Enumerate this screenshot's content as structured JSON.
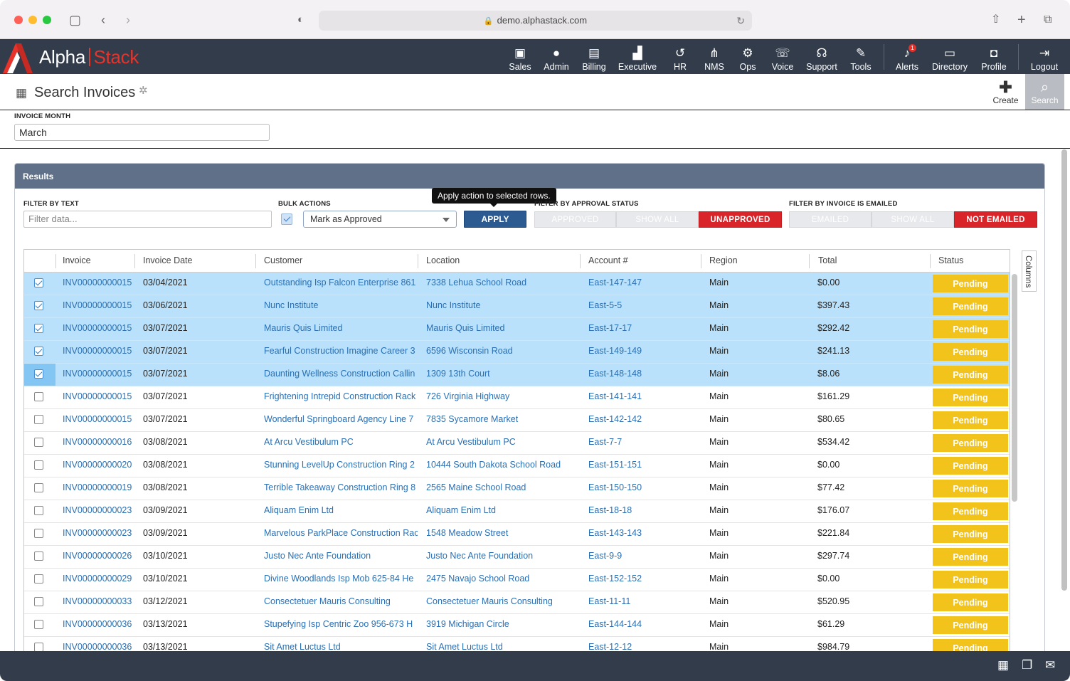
{
  "browser": {
    "url": "demo.alphastack.com"
  },
  "app": {
    "brand_part1": "Alpha",
    "brand_part2": "Stack",
    "accent_color": "#e8332a",
    "header_color": "#323c4b"
  },
  "nav": [
    {
      "label": "Sales",
      "icon": "sales-icon",
      "glyph": "▣"
    },
    {
      "label": "Admin",
      "icon": "admin-user-icon",
      "glyph": "●"
    },
    {
      "label": "Billing",
      "icon": "billing-icon",
      "glyph": "▤"
    },
    {
      "label": "Executive",
      "icon": "executive-chart-icon",
      "glyph": "▟"
    },
    {
      "label": "HR",
      "icon": "hr-icon",
      "glyph": "↺"
    },
    {
      "label": "NMS",
      "icon": "nms-network-icon",
      "glyph": "⋔"
    },
    {
      "label": "Ops",
      "icon": "ops-gears-icon",
      "glyph": "⚙"
    },
    {
      "label": "Voice",
      "icon": "voice-icon",
      "glyph": "☏"
    },
    {
      "label": "Support",
      "icon": "support-headset-icon",
      "glyph": "☊"
    },
    {
      "label": "Tools",
      "icon": "tools-wrench-icon",
      "glyph": "✎"
    },
    {
      "label": "Alerts",
      "icon": "alerts-bell-icon",
      "glyph": "♪",
      "badge": "1"
    },
    {
      "label": "Directory",
      "icon": "directory-icon",
      "glyph": "▭"
    },
    {
      "label": "Profile",
      "icon": "profile-icon",
      "glyph": "◘"
    },
    {
      "label": "Logout",
      "icon": "logout-icon",
      "glyph": "⇥"
    }
  ],
  "page": {
    "title": "Search Invoices",
    "create_label": "Create",
    "search_label": "Search"
  },
  "filters": {
    "invoice_month_label": "INVOICE MONTH",
    "invoice_month_value": "March"
  },
  "results": {
    "title": "Results",
    "filter_text_label": "FILTER BY TEXT",
    "filter_text_placeholder": "Filter data...",
    "bulk_actions_label": "BULK ACTIONS",
    "bulk_action_value": "Mark as Approved",
    "apply_label": "APPLY",
    "apply_tooltip": "Apply action to selected rows.",
    "approval_label": "FILTER BY APPROVAL STATUS",
    "approval_options": [
      "APPROVED",
      "SHOW ALL",
      "UNAPPROVED"
    ],
    "approval_active": "UNAPPROVED",
    "emailed_label": "FILTER BY INVOICE IS EMAILED",
    "emailed_options": [
      "EMAILED",
      "SHOW ALL",
      "NOT EMAILED"
    ],
    "emailed_active": "NOT EMAILED",
    "columns_tab": "Columns",
    "columns": [
      "Invoice",
      "Invoice Date",
      "Customer",
      "Location",
      "Account #",
      "Region",
      "Total",
      "Status"
    ],
    "rows": [
      {
        "selected": true,
        "invoice": "INV00000000015",
        "date": "03/04/2021",
        "customer": "Outstanding Isp Falcon Enterprise 861",
        "location": "7338 Lehua School Road",
        "account": "East-147-147",
        "region": "Main",
        "total": "$0.00",
        "status": "Pending"
      },
      {
        "selected": true,
        "invoice": "INV00000000015",
        "date": "03/06/2021",
        "customer": "Nunc Institute",
        "location": "Nunc Institute",
        "account": "East-5-5",
        "region": "Main",
        "total": "$397.43",
        "status": "Pending"
      },
      {
        "selected": true,
        "invoice": "INV00000000015",
        "date": "03/07/2021",
        "customer": "Mauris Quis Limited",
        "location": "Mauris Quis Limited",
        "account": "East-17-17",
        "region": "Main",
        "total": "$292.42",
        "status": "Pending"
      },
      {
        "selected": true,
        "invoice": "INV00000000015",
        "date": "03/07/2021",
        "customer": "Fearful Construction Imagine Career 3",
        "location": "6596 Wisconsin Road",
        "account": "East-149-149",
        "region": "Main",
        "total": "$241.13",
        "status": "Pending"
      },
      {
        "selected": true,
        "invoice": "INV00000000015",
        "date": "03/07/2021",
        "customer": "Daunting Wellness Construction Callin",
        "location": "1309 13th Court",
        "account": "East-148-148",
        "region": "Main",
        "total": "$8.06",
        "status": "Pending"
      },
      {
        "selected": false,
        "invoice": "INV00000000015",
        "date": "03/07/2021",
        "customer": "Frightening Intrepid Construction Rack",
        "location": "726 Virginia Highway",
        "account": "East-141-141",
        "region": "Main",
        "total": "$161.29",
        "status": "Pending"
      },
      {
        "selected": false,
        "invoice": "INV00000000015",
        "date": "03/07/2021",
        "customer": "Wonderful Springboard Agency Line 7",
        "location": "7835 Sycamore Market",
        "account": "East-142-142",
        "region": "Main",
        "total": "$80.65",
        "status": "Pending"
      },
      {
        "selected": false,
        "invoice": "INV00000000016",
        "date": "03/08/2021",
        "customer": "At Arcu Vestibulum PC",
        "location": "At Arcu Vestibulum PC",
        "account": "East-7-7",
        "region": "Main",
        "total": "$534.42",
        "status": "Pending"
      },
      {
        "selected": false,
        "invoice": "INV00000000020",
        "date": "03/08/2021",
        "customer": "Stunning LevelUp Construction Ring 2",
        "location": "10444 South Dakota School Road",
        "account": "East-151-151",
        "region": "Main",
        "total": "$0.00",
        "status": "Pending"
      },
      {
        "selected": false,
        "invoice": "INV00000000019",
        "date": "03/08/2021",
        "customer": "Terrible Takeaway Construction Ring 8",
        "location": "2565 Maine School Road",
        "account": "East-150-150",
        "region": "Main",
        "total": "$77.42",
        "status": "Pending"
      },
      {
        "selected": false,
        "invoice": "INV00000000023",
        "date": "03/09/2021",
        "customer": "Aliquam Enim Ltd",
        "location": "Aliquam Enim Ltd",
        "account": "East-18-18",
        "region": "Main",
        "total": "$176.07",
        "status": "Pending"
      },
      {
        "selected": false,
        "invoice": "INV00000000023",
        "date": "03/09/2021",
        "customer": "Marvelous ParkPlace Construction Rac",
        "location": "1548 Meadow Street",
        "account": "East-143-143",
        "region": "Main",
        "total": "$221.84",
        "status": "Pending"
      },
      {
        "selected": false,
        "invoice": "INV00000000026",
        "date": "03/10/2021",
        "customer": "Justo Nec Ante Foundation",
        "location": "Justo Nec Ante Foundation",
        "account": "East-9-9",
        "region": "Main",
        "total": "$297.74",
        "status": "Pending"
      },
      {
        "selected": false,
        "invoice": "INV00000000029",
        "date": "03/10/2021",
        "customer": "Divine Woodlands Isp Mob 625-84 He",
        "location": "2475 Navajo School Road",
        "account": "East-152-152",
        "region": "Main",
        "total": "$0.00",
        "status": "Pending"
      },
      {
        "selected": false,
        "invoice": "INV00000000033",
        "date": "03/12/2021",
        "customer": "Consectetuer Mauris Consulting",
        "location": "Consectetuer Mauris Consulting",
        "account": "East-11-11",
        "region": "Main",
        "total": "$520.95",
        "status": "Pending"
      },
      {
        "selected": false,
        "invoice": "INV00000000036",
        "date": "03/13/2021",
        "customer": "Stupefying Isp Centric Zoo 956-673 H",
        "location": "3919 Michigan Circle",
        "account": "East-144-144",
        "region": "Main",
        "total": "$61.29",
        "status": "Pending"
      },
      {
        "selected": false,
        "invoice": "INV00000000036",
        "date": "03/13/2021",
        "customer": "Sit Amet Luctus Ltd",
        "location": "Sit Amet Luctus Ltd",
        "account": "East-12-12",
        "region": "Main",
        "total": "$984.79",
        "status": "Pending"
      }
    ]
  },
  "status_color": "#f2c31a",
  "active_filter_color": "#d9242a",
  "footer_icons": [
    "calendar-icon",
    "notes-icon",
    "chat-icon"
  ]
}
